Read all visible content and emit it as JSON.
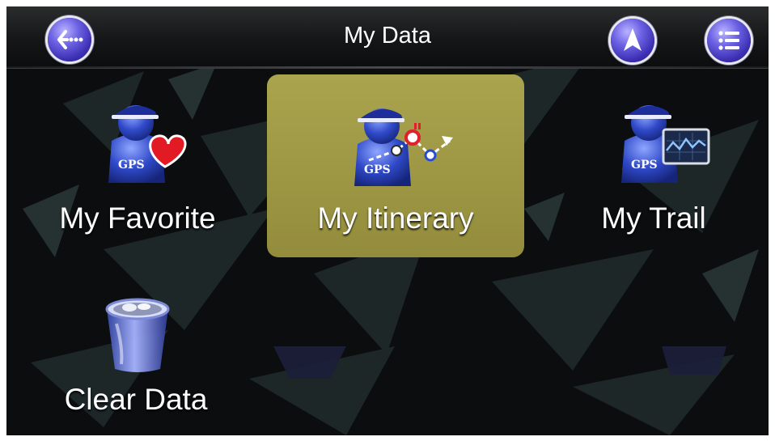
{
  "header": {
    "title": "My Data",
    "back_icon": "back-icon",
    "navigation_icon": "navigation-arrow-icon",
    "menu_icon": "menu-list-icon"
  },
  "tiles": [
    {
      "label": "My Favorite",
      "icon": "user-gps-heart-icon",
      "selected": false
    },
    {
      "label": "My Itinerary",
      "icon": "user-gps-route-icon",
      "selected": true
    },
    {
      "label": "My Trail",
      "icon": "user-gps-trail-icon",
      "selected": false
    },
    {
      "label": "Clear Data",
      "icon": "trash-bin-icon",
      "selected": false
    }
  ],
  "icon_text": {
    "gps": "GPS"
  },
  "colors": {
    "background": "#0b0d0e",
    "selected_tile": "#a39d48",
    "button_accent": "#5a4fd6",
    "text": "#ffffff"
  }
}
